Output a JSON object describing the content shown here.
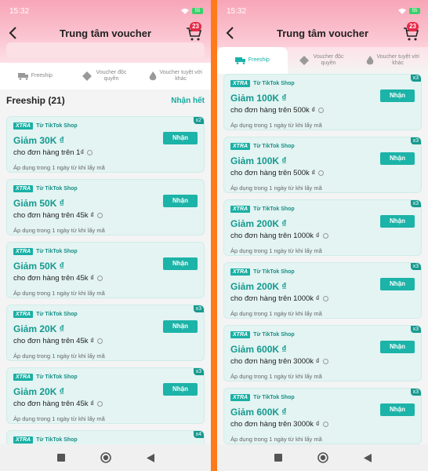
{
  "left": {
    "status_time": "15:32",
    "battery": "55",
    "title": "Trung tâm voucher",
    "cart_badge": "23",
    "tabs": [
      {
        "label": "Freeship"
      },
      {
        "label": "Voucher độc quyền"
      },
      {
        "label": "Voucher tuyệt vời khác"
      }
    ],
    "section_title": "Freeship (21)",
    "claim_all": "Nhận hết",
    "vouchers": [
      {
        "xtra": "XTRA",
        "source": "Từ TikTok Shop",
        "amount": "Giảm 30K ₫",
        "condition": "cho đơn hàng trên 1₫",
        "note": "Áp dụng trong 1 ngày từ khi lấy mã",
        "button": "Nhận",
        "mult": "x2"
      },
      {
        "xtra": "XTRA",
        "source": "Từ TikTok Shop",
        "amount": "Giảm 50K ₫",
        "condition": "cho đơn hàng trên 45k ₫",
        "note": "Áp dụng trong 1 ngày từ khi lấy mã",
        "button": "Nhận",
        "mult": ""
      },
      {
        "xtra": "XTRA",
        "source": "Từ TikTok Shop",
        "amount": "Giảm 50K ₫",
        "condition": "cho đơn hàng trên 45k ₫",
        "note": "Áp dụng trong 1 ngày từ khi lấy mã",
        "button": "Nhận",
        "mult": ""
      },
      {
        "xtra": "XTRA",
        "source": "Từ TikTok Shop",
        "amount": "Giảm 20K ₫",
        "condition": "cho đơn hàng trên 45k ₫",
        "note": "Áp dụng trong 1 ngày từ khi lấy mã",
        "button": "Nhận",
        "mult": "x3"
      },
      {
        "xtra": "XTRA",
        "source": "Từ TikTok Shop",
        "amount": "Giảm 20K ₫",
        "condition": "cho đơn hàng trên 45k ₫",
        "note": "Áp dụng trong 1 ngày từ khi lấy mã",
        "button": "Nhận",
        "mult": "x3"
      },
      {
        "xtra": "XTRA",
        "source": "Từ TikTok Shop",
        "amount": "",
        "condition": "",
        "note": "",
        "button": "",
        "mult": "x4"
      }
    ]
  },
  "right": {
    "status_time": "15:32",
    "battery": "55",
    "title": "Trung tâm voucher",
    "cart_badge": "23",
    "tabs": [
      {
        "label": "Freeship"
      },
      {
        "label": "Voucher độc quyền"
      },
      {
        "label": "Voucher tuyệt vời khác"
      }
    ],
    "vouchers": [
      {
        "xtra": "XTRA",
        "source": "Từ TikTok Shop",
        "amount": "Giảm 100K ₫",
        "condition": "cho đơn hàng trên 500k ₫",
        "note": "Áp dụng trong 1 ngày từ khi lấy mã",
        "button": "Nhận",
        "mult": "x3"
      },
      {
        "xtra": "XTRA",
        "source": "Từ TikTok Shop",
        "amount": "Giảm 100K ₫",
        "condition": "cho đơn hàng trên 500k ₫",
        "note": "Áp dụng trong 1 ngày từ khi lấy mã",
        "button": "Nhận",
        "mult": "x3"
      },
      {
        "xtra": "XTRA",
        "source": "Từ TikTok Shop",
        "amount": "Giảm 200K ₫",
        "condition": "cho đơn hàng trên 1000k ₫",
        "note": "Áp dụng trong 1 ngày từ khi lấy mã",
        "button": "Nhận",
        "mult": "x3"
      },
      {
        "xtra": "XTRA",
        "source": "Từ TikTok Shop",
        "amount": "Giảm 200K ₫",
        "condition": "cho đơn hàng trên 1000k ₫",
        "note": "Áp dụng trong 1 ngày từ khi lấy mã",
        "button": "Nhận",
        "mult": "x3"
      },
      {
        "xtra": "XTRA",
        "source": "Từ TikTok Shop",
        "amount": "Giảm 600K ₫",
        "condition": "cho đơn hàng trên 3000k ₫",
        "note": "Áp dụng trong 1 ngày từ khi lấy mã",
        "button": "Nhận",
        "mult": "x3"
      },
      {
        "xtra": "XTRA",
        "source": "Từ TikTok Shop",
        "amount": "Giảm 600K ₫",
        "condition": "cho đơn hàng trên 3000k ₫",
        "note": "Áp dụng trong 1 ngày từ khi lấy mã",
        "button": "Nhận",
        "mult": "x3"
      }
    ]
  },
  "colors": {
    "accent": "#1cb3a8",
    "badge": "#e62845",
    "divider": "#ff7a1a"
  },
  "icons": [
    "back-arrow-icon",
    "cart-icon",
    "truck-icon",
    "diamond-icon",
    "flame-icon",
    "home-square-icon",
    "home-circle-icon",
    "back-triangle-icon"
  ]
}
